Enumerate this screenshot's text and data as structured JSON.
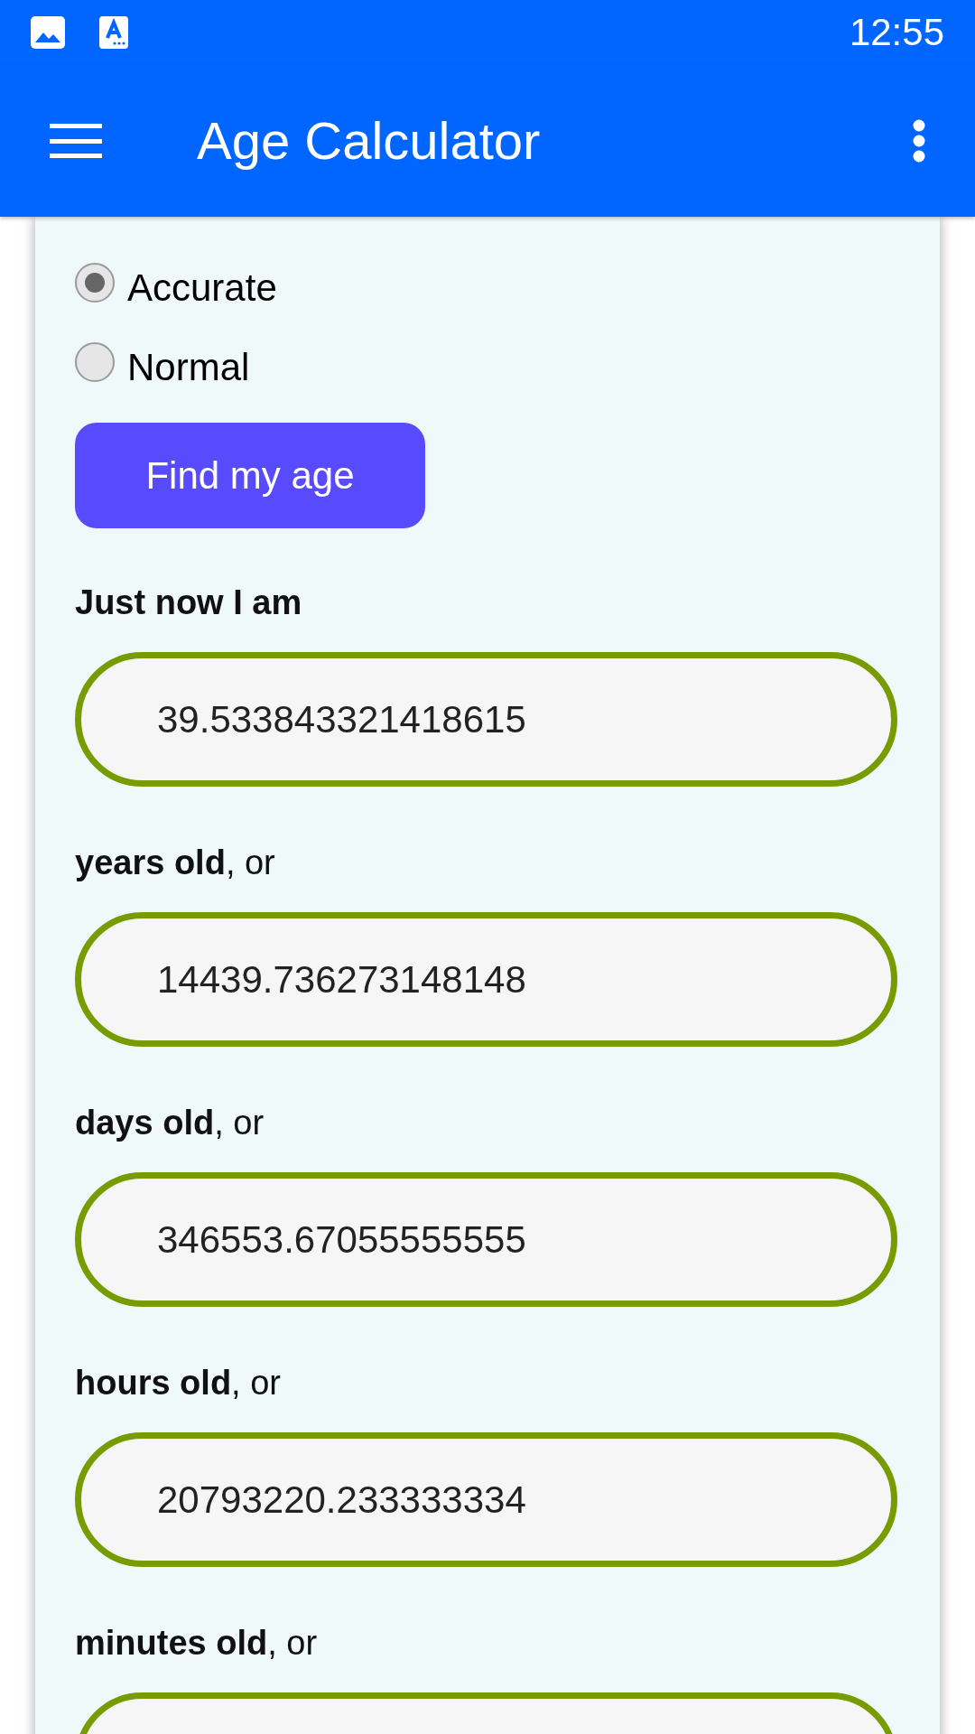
{
  "status_bar": {
    "time": "12:55"
  },
  "app_bar": {
    "title": "Age Calculator"
  },
  "mode_options": [
    {
      "label": "Accurate",
      "selected": true
    },
    {
      "label": "Normal",
      "selected": false
    }
  ],
  "find_button": {
    "label": "Find my age"
  },
  "results": [
    {
      "kind": "heading",
      "label": "Just now I am",
      "value": "39.533843321418615"
    },
    {
      "kind": "unit",
      "label": "**years old**, or",
      "value": "14439.736273148148"
    },
    {
      "kind": "unit",
      "label": "**days old**, or",
      "value": "346553.67055555555"
    },
    {
      "kind": "unit",
      "label": "**hours old**, or",
      "value": "20793220.233333334"
    },
    {
      "kind": "unit",
      "label": "**minutes old**, or"
    }
  ]
}
